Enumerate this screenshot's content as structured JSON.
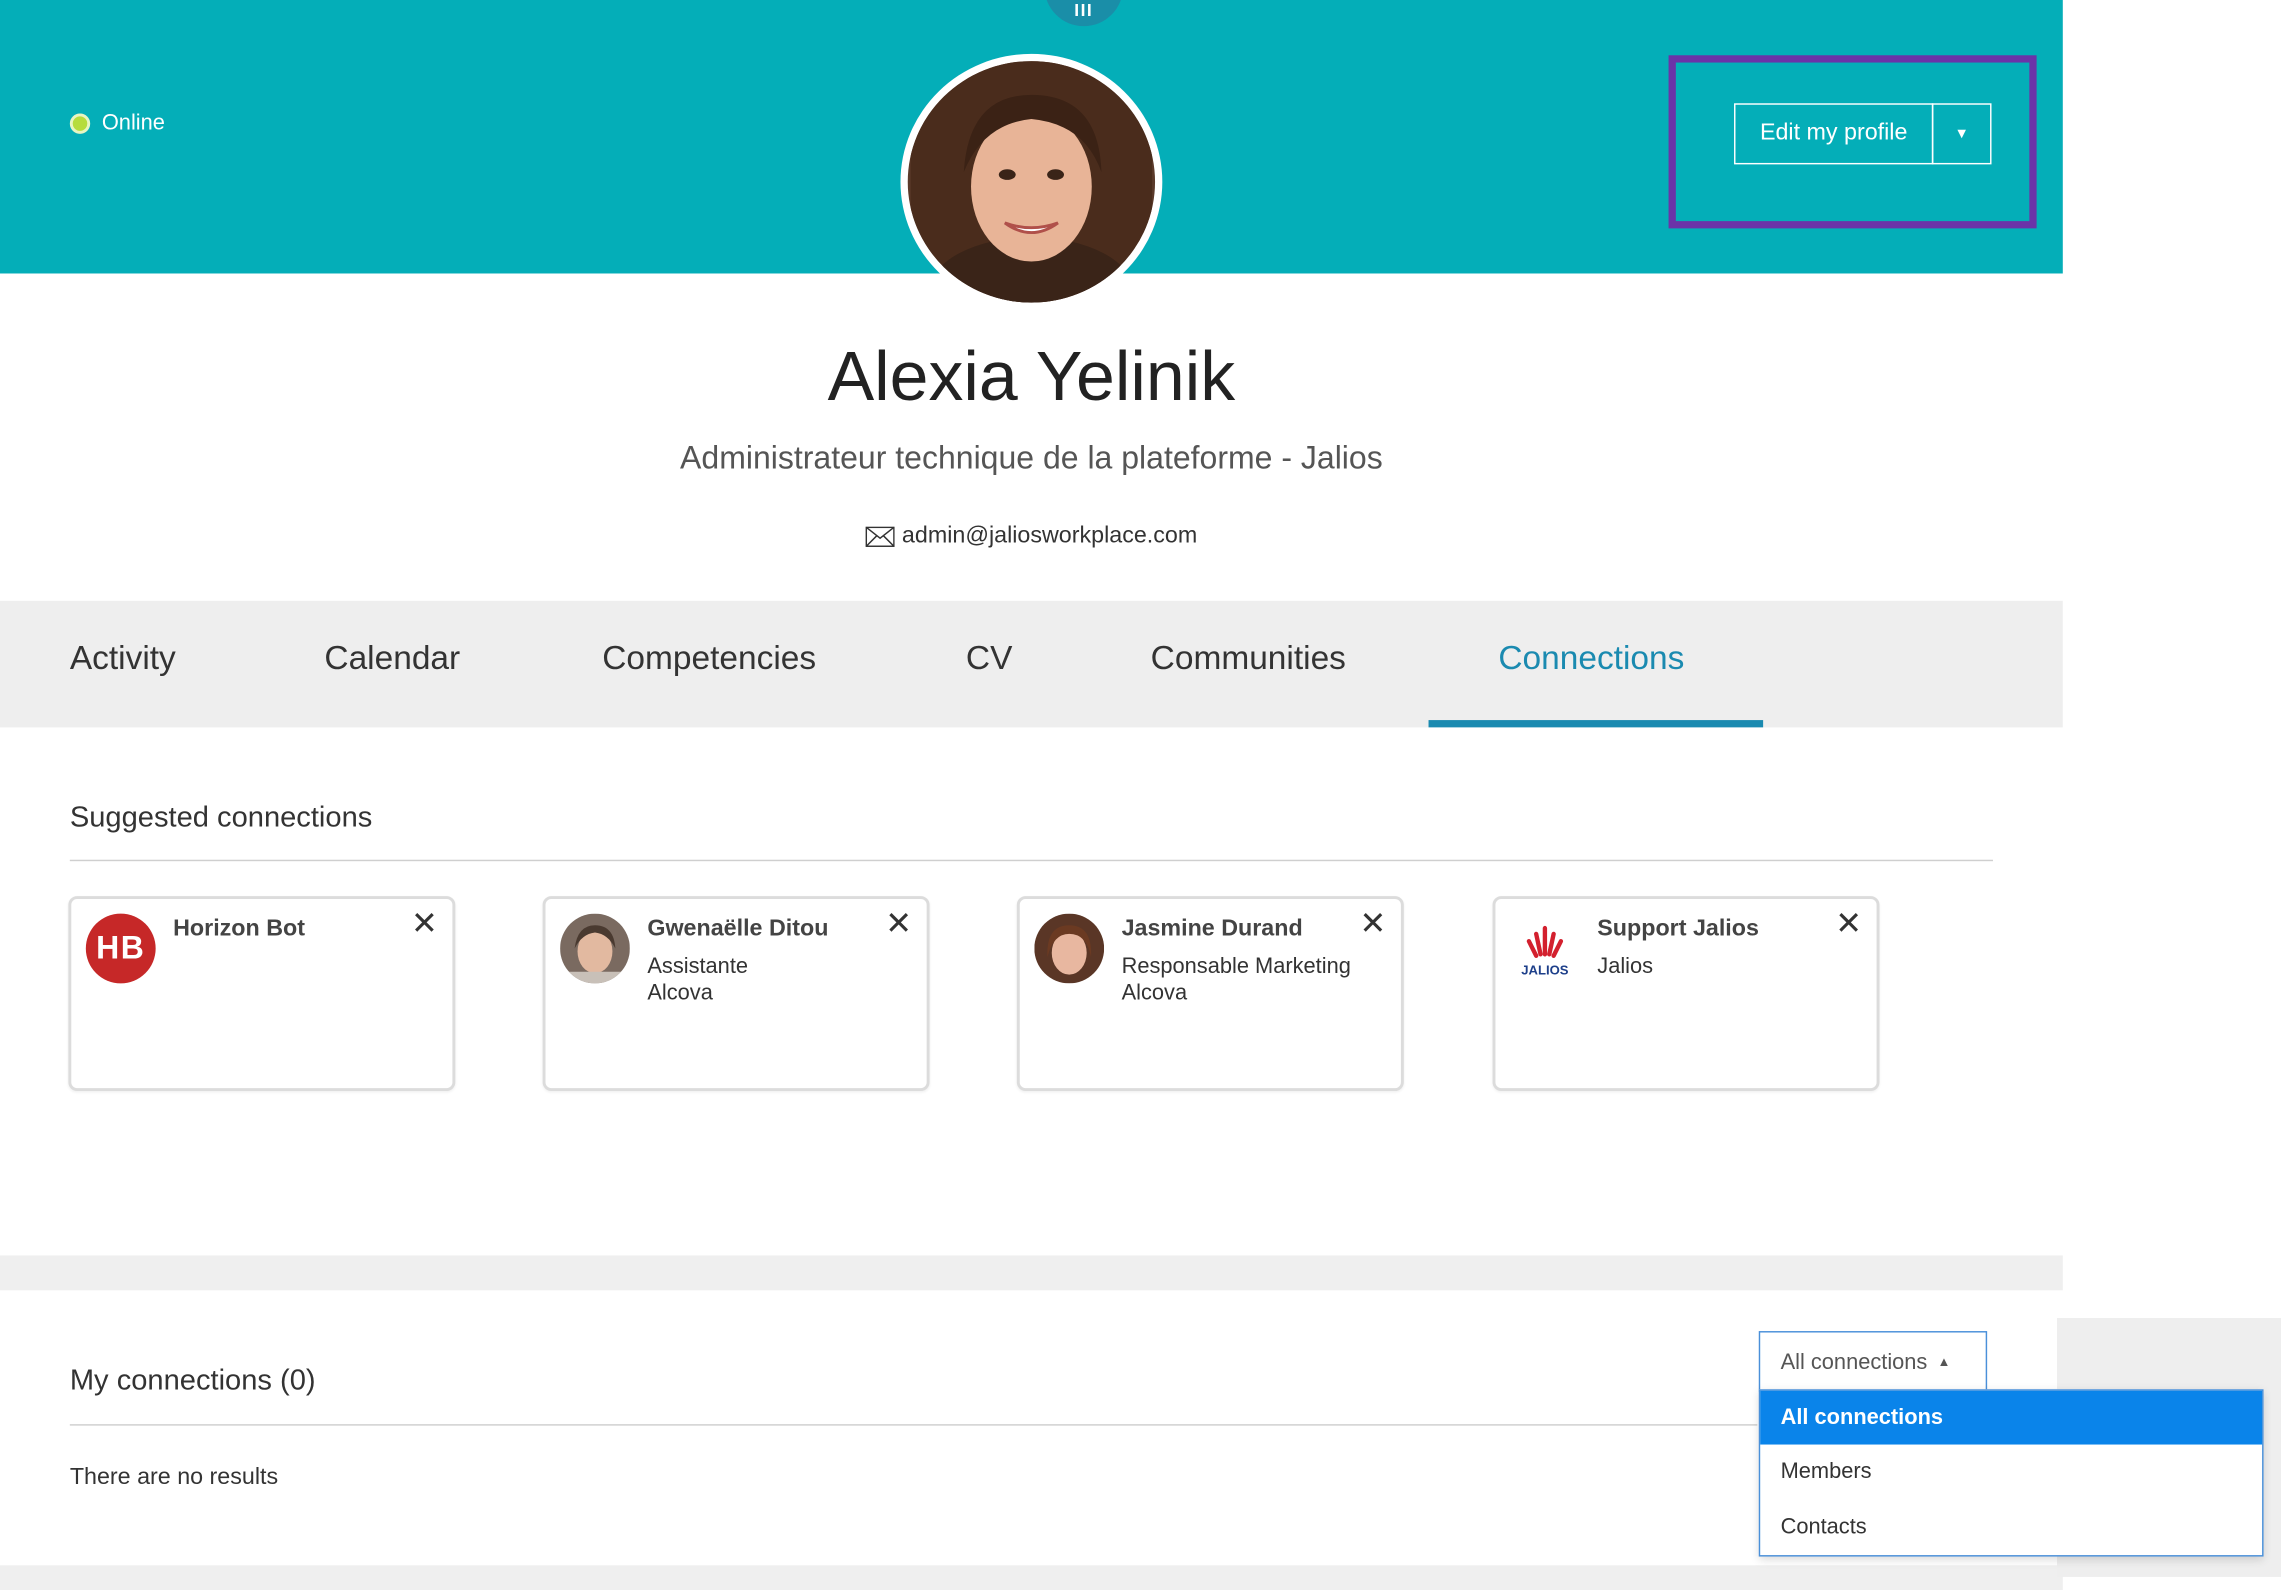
{
  "status": {
    "label": "Online",
    "color": "#b6dc3c"
  },
  "banner": {
    "color": "#04aeb8",
    "handle_label": "III"
  },
  "profile": {
    "name": "Alexia Yelinik",
    "title": "Administrateur technique de la plateforme - Jalios",
    "email": "admin@jaliosworkplace.com",
    "email_icon": "envelope-icon"
  },
  "actions": {
    "edit_label": "Edit my profile",
    "dropdown_icon": "caret-down-icon"
  },
  "tabs": [
    {
      "label": "Activity",
      "active": false
    },
    {
      "label": "Calendar",
      "active": false
    },
    {
      "label": "Competencies",
      "active": false
    },
    {
      "label": "CV",
      "active": false
    },
    {
      "label": "Communities",
      "active": false
    },
    {
      "label": "Connections",
      "active": true
    }
  ],
  "accent_color": "#1a8ab0",
  "suggested": {
    "title": "Suggested connections",
    "cards": [
      {
        "name": "Horizon Bot",
        "initials": "HB",
        "lines": []
      },
      {
        "name": "Gwenaëlle Ditou",
        "lines": [
          "Assistante",
          "Alcova"
        ]
      },
      {
        "name": "Jasmine Durand",
        "lines": [
          "Responsable Marketing",
          "Alcova"
        ]
      },
      {
        "name": "Support Jalios",
        "logo_text": "JALIOS",
        "lines": [
          "Jalios"
        ]
      }
    ],
    "close_icon": "close-icon",
    "close_glyph": "✕"
  },
  "my_connections": {
    "title": "My connections (0)",
    "empty_text": "There are no results",
    "filter": {
      "selected": "All connections",
      "options": [
        "All connections",
        "Members",
        "Contacts"
      ]
    }
  }
}
